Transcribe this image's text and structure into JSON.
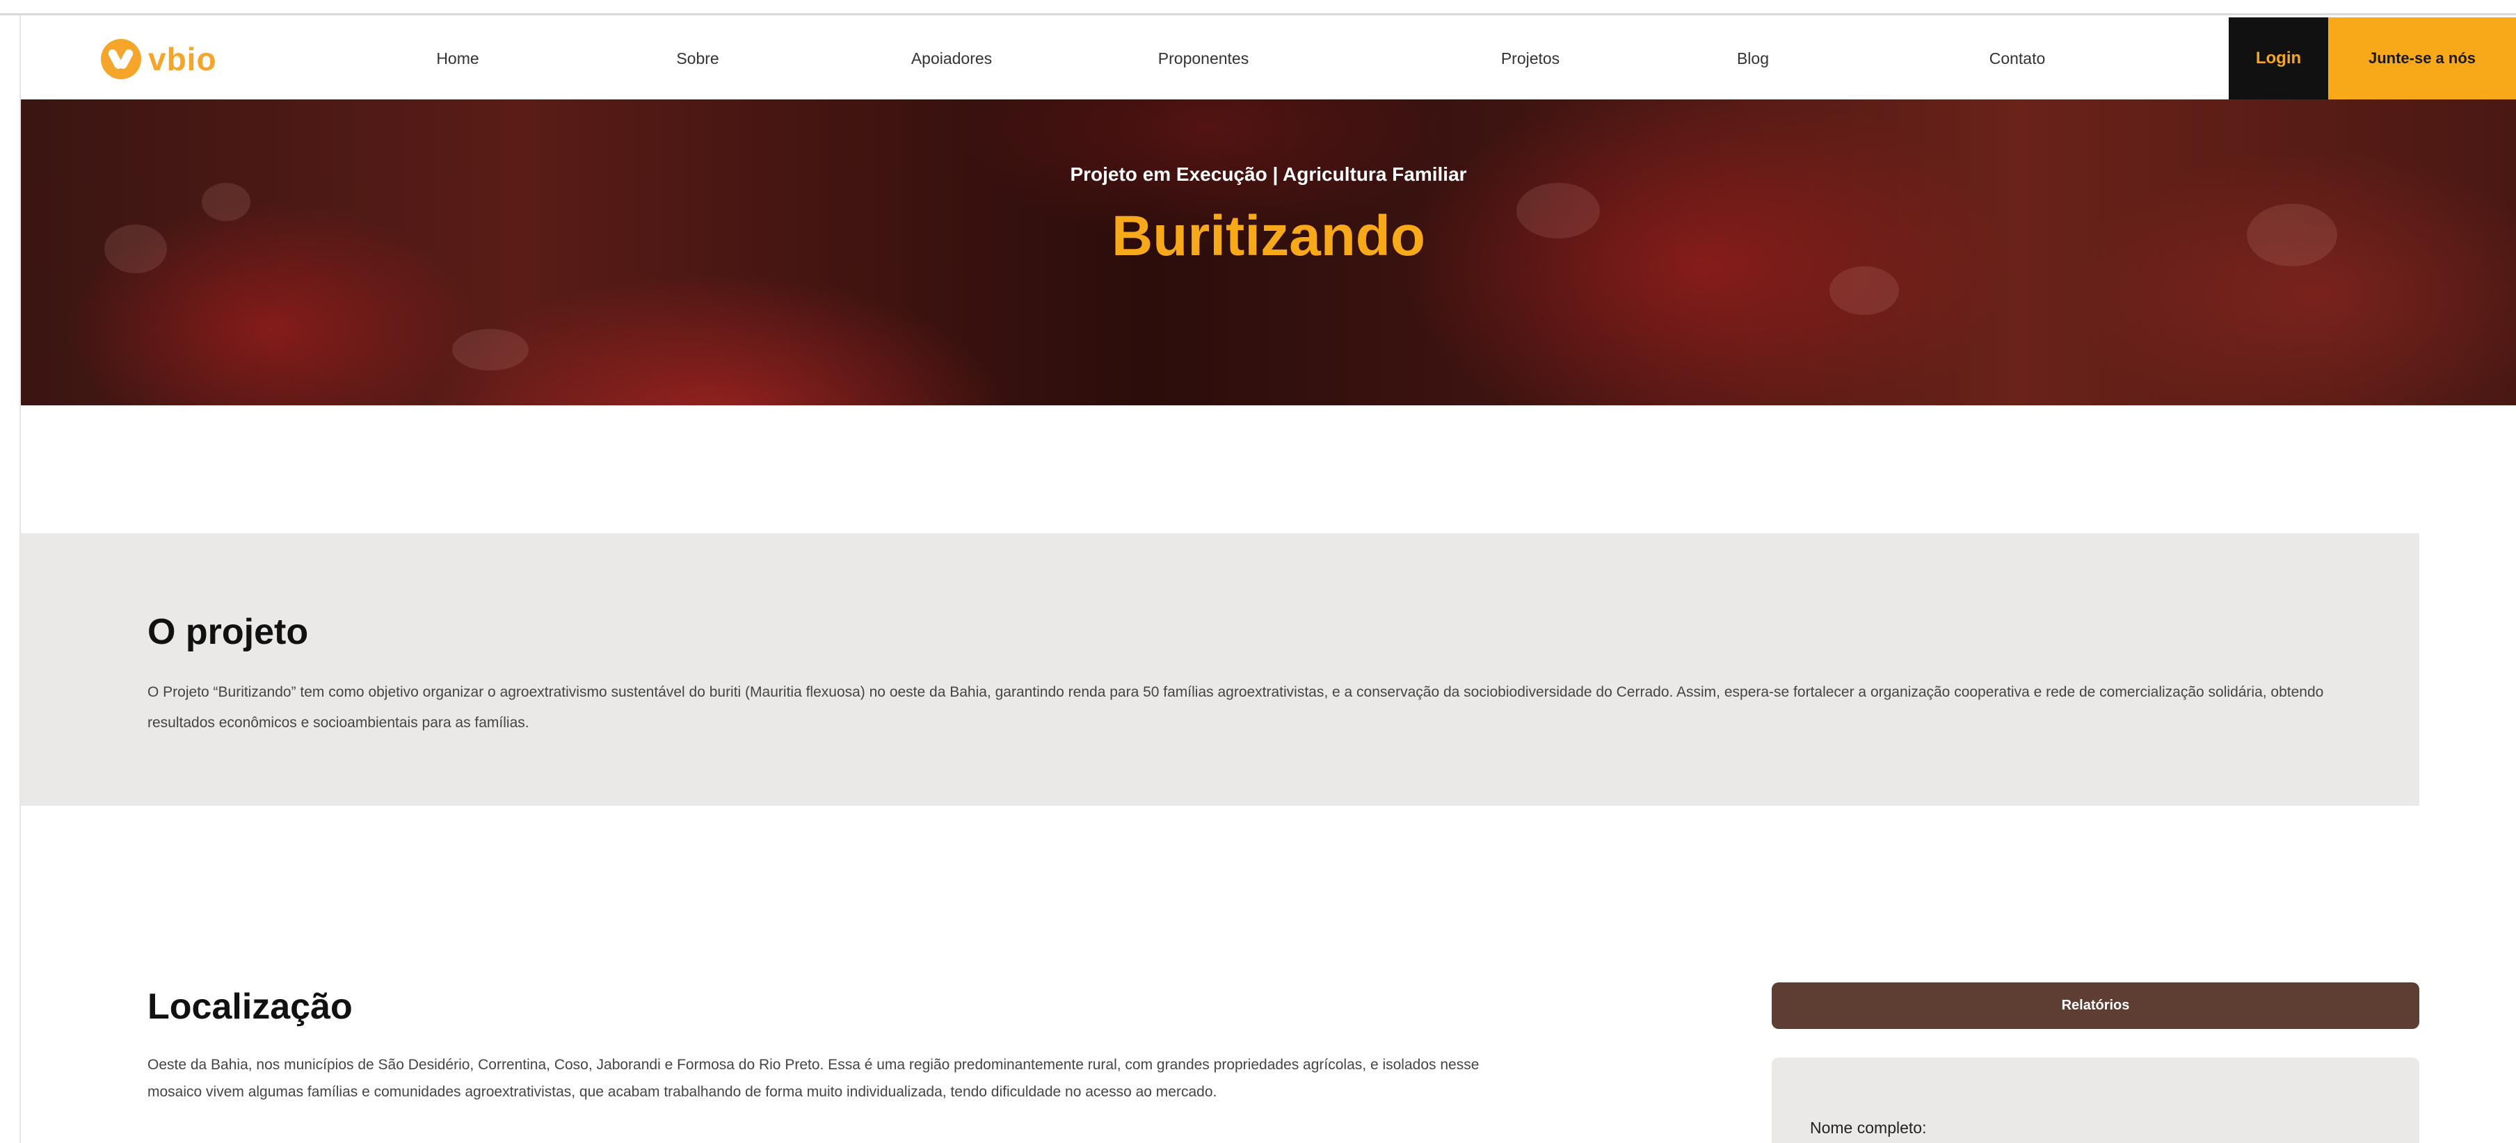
{
  "nav": {
    "logo_text": "vbio",
    "items": [
      "Home",
      "Sobre",
      "Apoiadores",
      "Proponentes",
      "Projetos",
      "Blog",
      "Contato"
    ],
    "login_label": "Login",
    "join_label": "Junte-se a nós",
    "colors": {
      "accent": "#f7a91a",
      "login_bg": "#111111"
    }
  },
  "hero": {
    "subtitle": "Projeto em Execução  |  Agricultura Familiar",
    "title": "Buritizando"
  },
  "project": {
    "heading": "O projeto",
    "text": "O Projeto “Buritizando” tem como objetivo organizar o agroextrativismo sustentável do buriti (Mauritia flexuosa) no oeste da Bahia, garantindo renda para 50 famílias agroextrativistas, e a conservação da sociobiodiversidade do Cerrado. Assim, espera-se fortalecer a organização cooperativa e rede de comercialização solidária, obtendo resultados econômicos e socioambientais para as famílias."
  },
  "location": {
    "heading": "Localização",
    "text": "Oeste da Bahia, nos municípios de São Desidério, Correntina, Coso, Jaborandi e Formosa do Rio Preto. Essa é uma região predominantemente rural, com grandes propriedades agrícolas, e isolados nesse mosaico vivem algumas famílias e comunidades agroextrativistas, que acabam trabalhando de forma muito individualizada, tendo dificuldade no acesso ao mercado."
  },
  "sidebar": {
    "reports_label": "Relatórios",
    "form_name_label": "Nome completo:",
    "colors": {
      "reports_bg": "#5e3d33",
      "card_bg": "#ebe9e7"
    }
  }
}
